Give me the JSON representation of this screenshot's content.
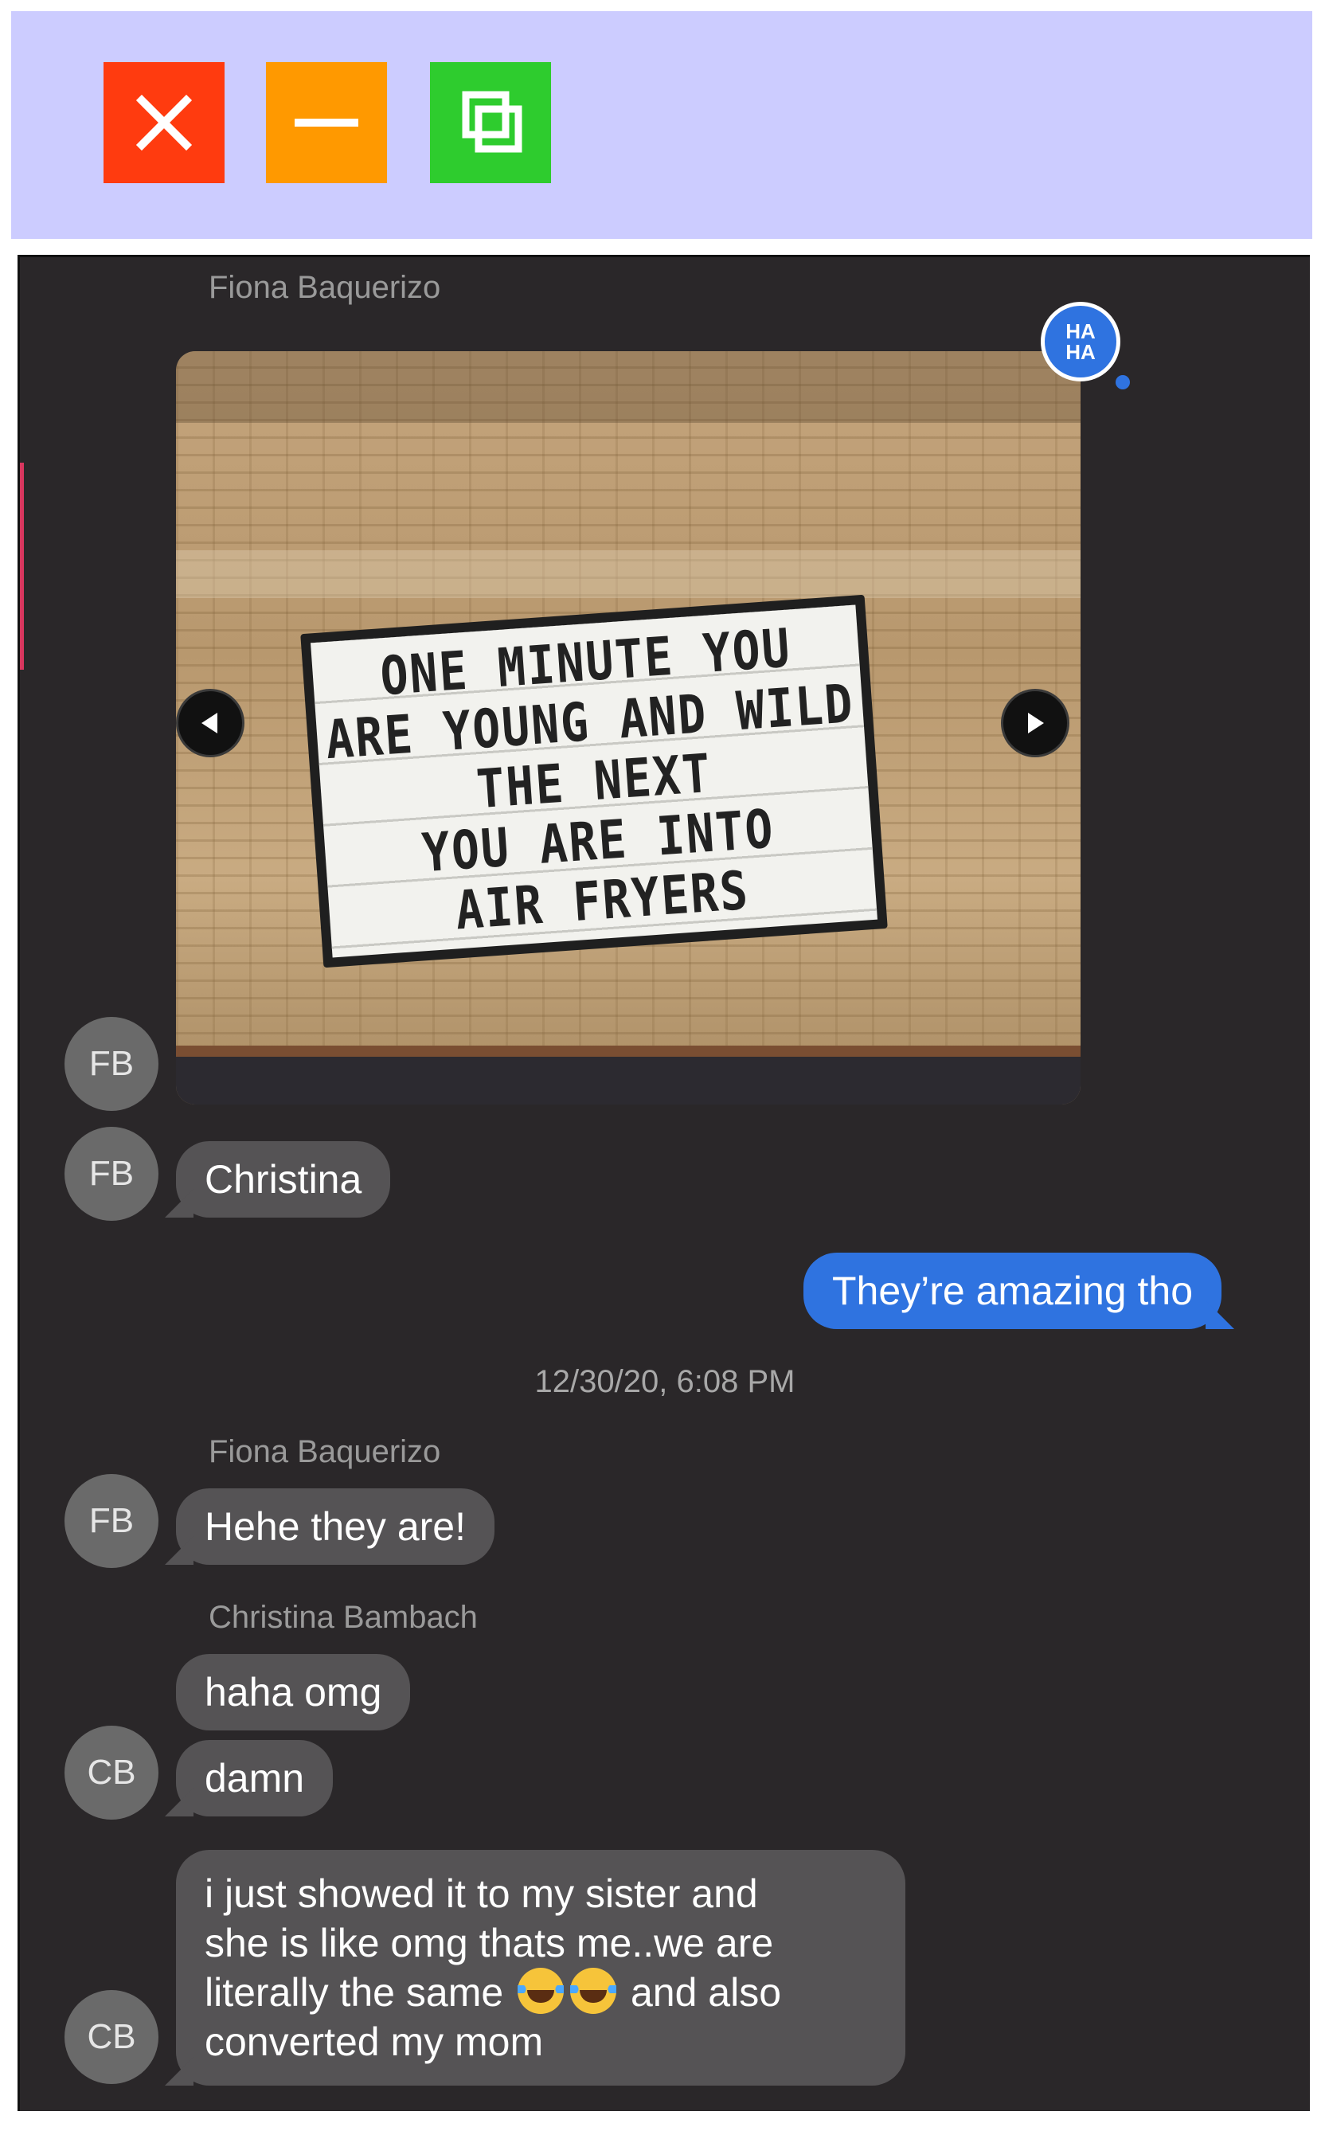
{
  "window": {
    "buttons": {
      "close": "close-icon",
      "minimize": "minimize-icon",
      "maximize": "maximize-icon"
    },
    "colors": {
      "titlebar": "#ccccff",
      "close": "#ff3b0f",
      "minimize": "#ff9900",
      "maximize": "#2ecc2e"
    }
  },
  "chat": {
    "background": "#2a2729",
    "incoming_bubble_color": "#555355",
    "outgoing_bubble_color": "#2f73e0",
    "messages": {
      "fb_sender_1": "Fiona Baquerizo",
      "fb_avatar": "FB",
      "photo_sign_lines": [
        "ONE MINUTE YOU",
        "ARE YOUNG AND WILD",
        "THE NEXT",
        "YOU ARE INTO",
        "AIR FRYERS"
      ],
      "photo_reaction_line1": "HA",
      "photo_reaction_line2": "HA",
      "fb_msg_christina": "Christina",
      "me_msg_1": "They’re amazing tho",
      "timestamp": "12/30/20, 6:08 PM",
      "fb_sender_2": "Fiona Baquerizo",
      "fb_msg_hehe": "Hehe they are!",
      "cb_sender": "Christina Bambach",
      "cb_avatar": "CB",
      "cb_msg_1": "haha omg",
      "cb_msg_2": "damn",
      "cb_msg_3_line1": "i just showed it to my sister and",
      "cb_msg_3_line2": "she is like omg thats me..we are",
      "cb_msg_3_line3a": "literally the same",
      "cb_msg_3_line3b": "and also",
      "cb_msg_3_line4": "converted my mom"
    }
  }
}
